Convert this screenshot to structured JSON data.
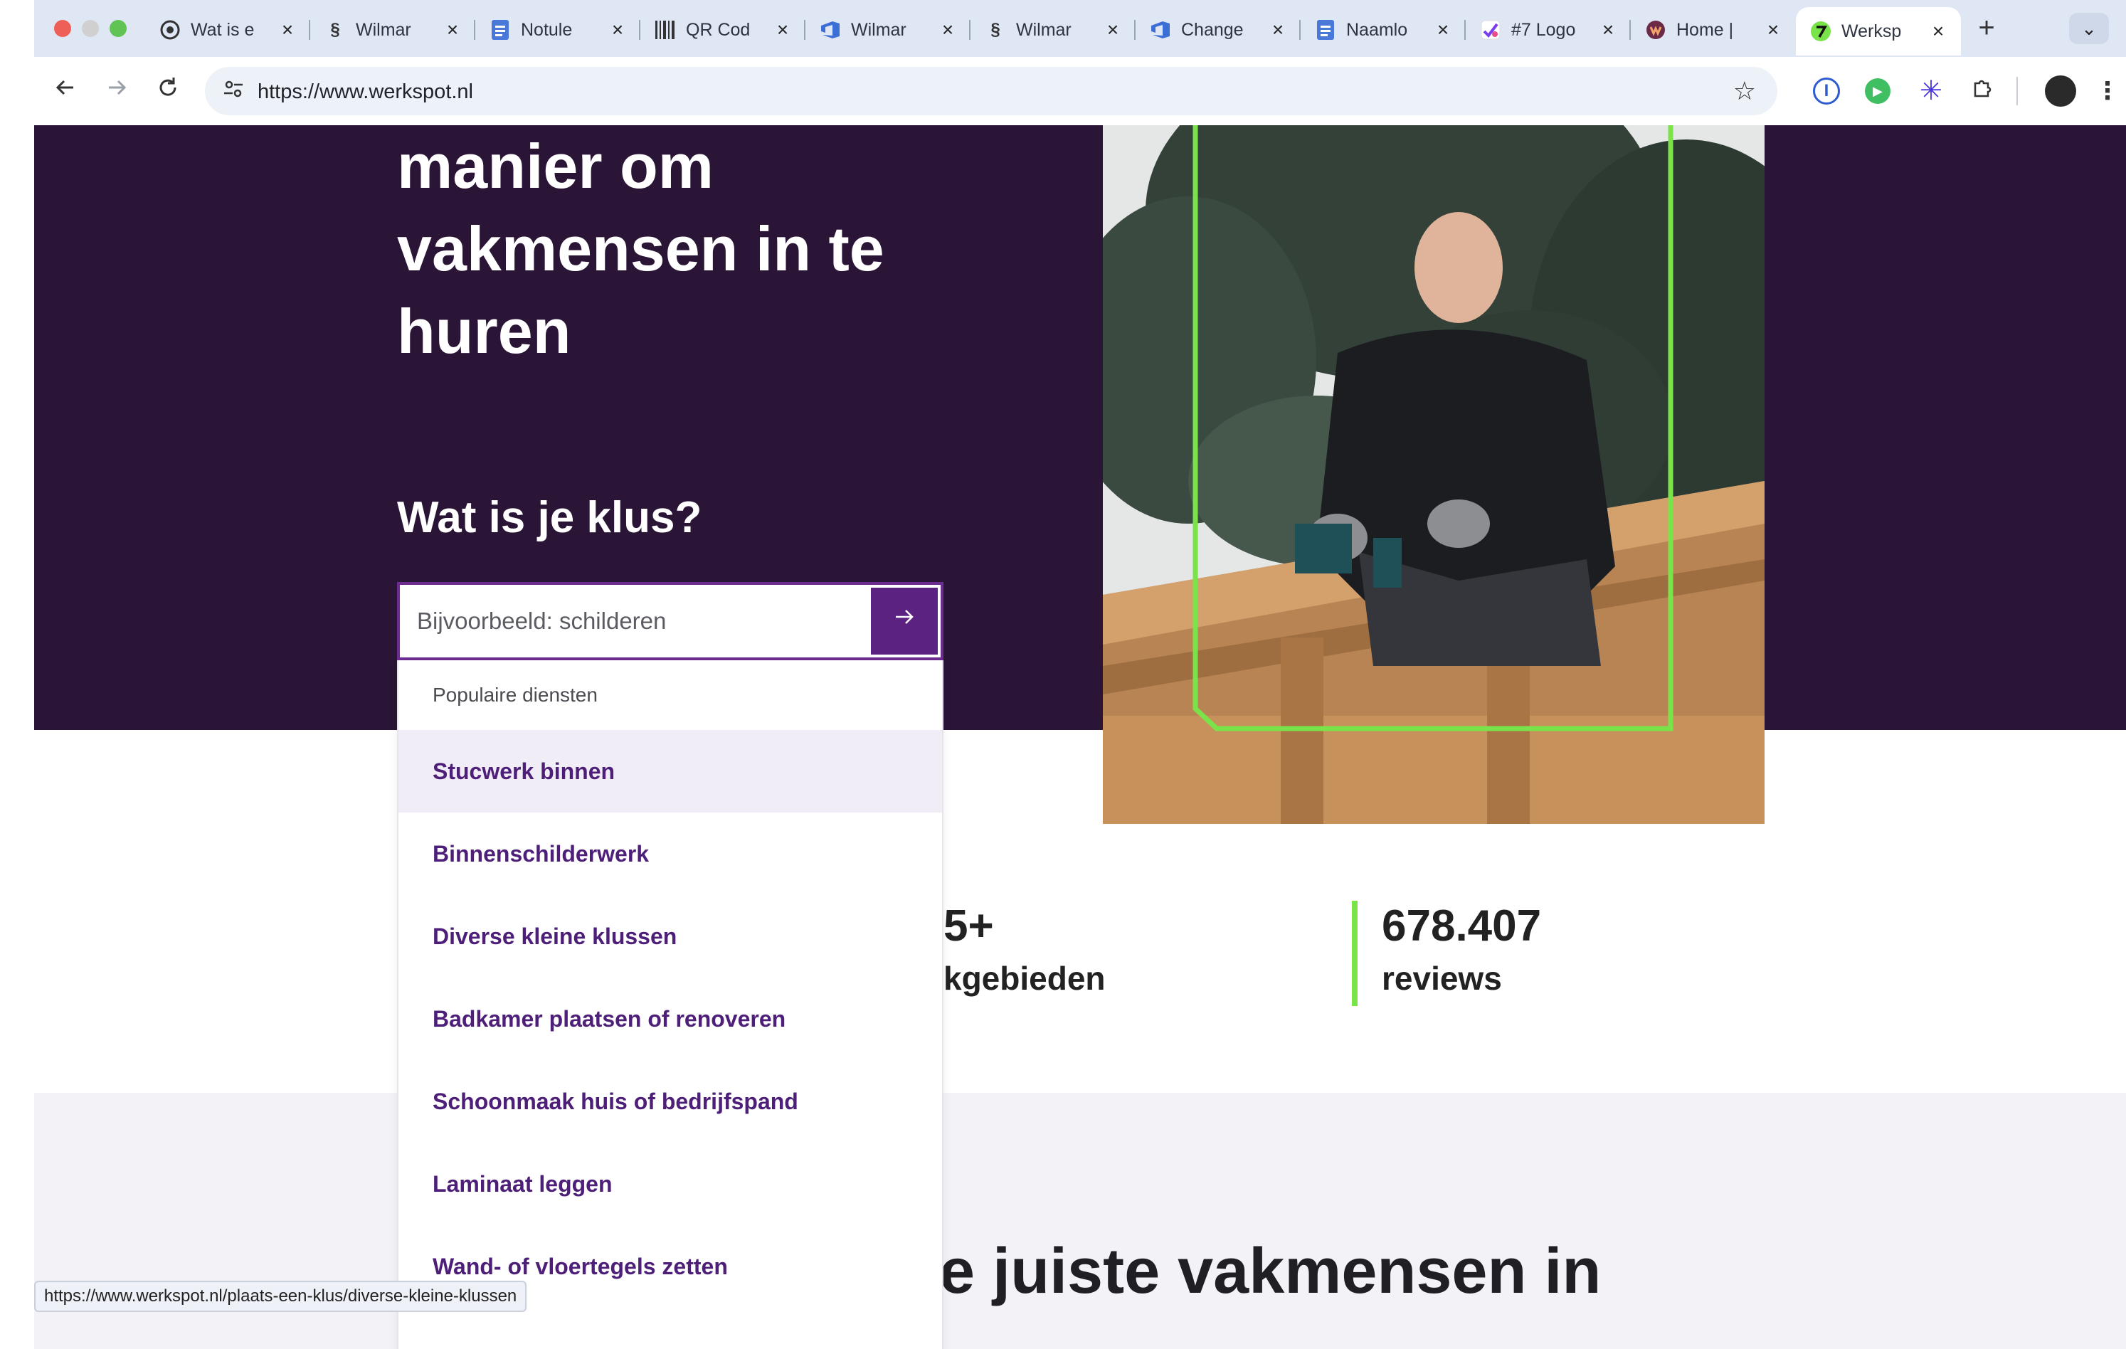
{
  "browser": {
    "tabs": [
      {
        "title": "Wat is e",
        "icon": "chrome-icon"
      },
      {
        "title": "Wilmar",
        "icon": "s-logo-icon"
      },
      {
        "title": "Notule",
        "icon": "docs-icon"
      },
      {
        "title": "QR Cod",
        "icon": "barcode-icon"
      },
      {
        "title": "Wilmar",
        "icon": "azure-devops-icon"
      },
      {
        "title": "Wilmar",
        "icon": "s-logo-icon"
      },
      {
        "title": "Change",
        "icon": "azure-devops-icon"
      },
      {
        "title": "Naamlo",
        "icon": "docs-icon"
      },
      {
        "title": "#7 Logo",
        "icon": "logo-icon"
      },
      {
        "title": "Home |",
        "icon": "werkspot-icon"
      },
      {
        "title": "Werksp",
        "icon": "werkspot-green-icon",
        "active": true
      }
    ],
    "url": "https://www.werkspot.nl",
    "status_url": "https://www.werkspot.nl/plaats-een-klus/diverse-kleine-klussen"
  },
  "hero": {
    "headline_lines": [
      "manier om",
      "vakmensen in te",
      "huren"
    ],
    "question": "Wat is je klus?",
    "search_placeholder": "Bijvoorbeeld: schilderen"
  },
  "dropdown": {
    "header": "Populaire diensten",
    "hovered_index": 0,
    "items": [
      "Stucwerk binnen",
      "Binnenschilderwerk",
      "Diverse kleine klussen",
      "Badkamer plaatsen of renoveren",
      "Schoonmaak huis of bedrijfspand",
      "Laminaat leggen",
      "Wand- of vloertegels zetten"
    ]
  },
  "stats": {
    "partial_value": "5+",
    "partial_label": "kgebieden",
    "value": "678.407",
    "label": "reviews"
  },
  "lower": {
    "heading_partial": "e juiste vakmensen in"
  },
  "colors": {
    "hero_bg": "#2b1537",
    "accent_purple": "#5b2281",
    "accent_green": "#7be34a",
    "item_text": "#4d1f78"
  }
}
